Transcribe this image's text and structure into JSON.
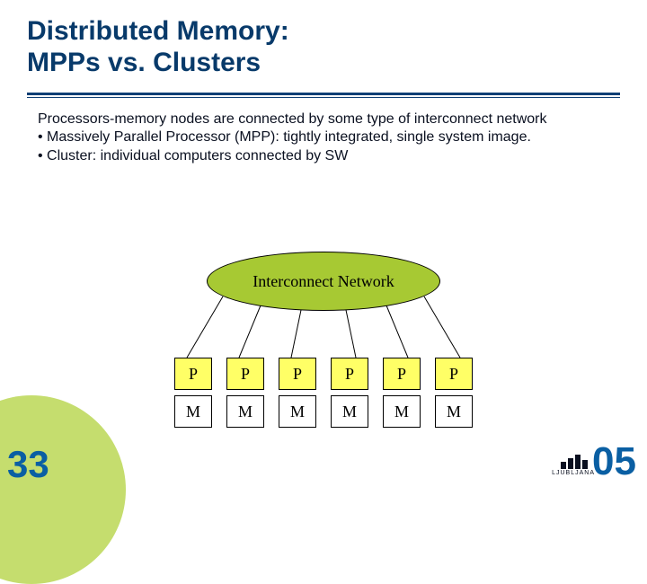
{
  "title": {
    "line1": "Distributed Memory:",
    "line2": "MPPs vs. Clusters"
  },
  "body": {
    "intro": "Processors-memory nodes are connected by some type of interconnect network",
    "bullets": [
      "Massively Parallel Processor (MPP): tightly integrated, single system image.",
      "Cluster: individual computers connected by SW"
    ]
  },
  "diagram": {
    "interconnect_label": "Interconnect Network",
    "p_labels": [
      "P",
      "P",
      "P",
      "P",
      "P",
      "P"
    ],
    "m_labels": [
      "M",
      "M",
      "M",
      "M",
      "M",
      "M"
    ]
  },
  "footer": {
    "slide_number": "33",
    "logo_text": "LJUBLJANA",
    "year_suffix": "05"
  }
}
